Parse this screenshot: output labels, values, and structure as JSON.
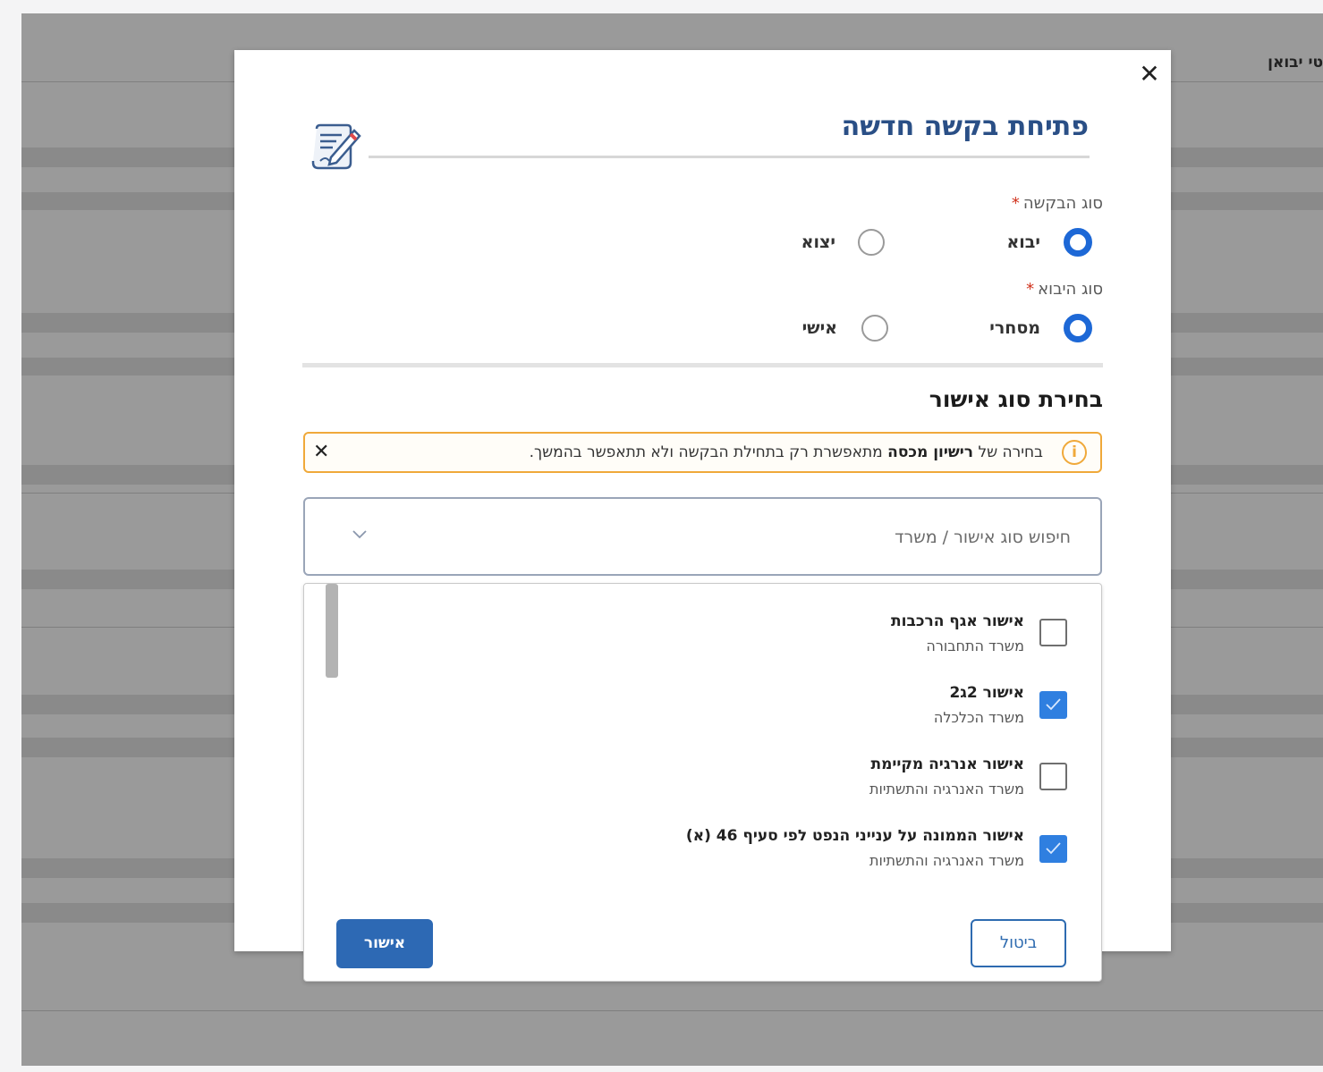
{
  "background": {
    "title_fragment": "טי יבואן"
  },
  "modal": {
    "title": "פתיחת בקשה חדשה",
    "title_icon": "edit-document-icon",
    "close_icon": "close-icon",
    "request_type": {
      "label": "סוג הבקשה",
      "required_mark": "*",
      "options": [
        {
          "label": "יבוא",
          "selected": true
        },
        {
          "label": "יצוא",
          "selected": false
        }
      ]
    },
    "import_type": {
      "label": "סוג היבוא",
      "required_mark": "*",
      "options": [
        {
          "label": "מסחרי",
          "selected": true
        },
        {
          "label": "אישי",
          "selected": false
        }
      ]
    },
    "section_title": "בחירת סוג אישור",
    "alert": {
      "icon": "info-icon",
      "icon_glyph": "i",
      "prefix": "בחירה של",
      "bold": "רישיון מכסה",
      "suffix": "מתאפשרת רק בתחילת הבקשה ולא תתאפשר בהמשך.",
      "close": "✕"
    },
    "search": {
      "placeholder": "חיפוש סוג אישור / משרד",
      "chevron_icon": "chevron-down-icon"
    },
    "list_items": [
      {
        "title": "אישור אגף הרכבות",
        "subtitle": "משרד התחבורה",
        "checked": false
      },
      {
        "title": "אישור 2ג2",
        "subtitle": "משרד הכלכלה",
        "checked": true
      },
      {
        "title": "אישור אנרגיה מקיימת",
        "subtitle": "משרד האנרגיה והתשתיות",
        "checked": false
      },
      {
        "title": "אישור הממונה על ענייני הנפט לפי סעיף 46 (א)",
        "subtitle": "משרד האנרגיה והתשתיות",
        "checked": true
      }
    ],
    "buttons": {
      "cancel": "ביטול",
      "confirm": "אישור"
    },
    "colors": {
      "accent": "#1d68d6",
      "title": "#2a4f86",
      "alert_border": "#f0a93a",
      "confirm_bg": "#2d69b4"
    }
  }
}
